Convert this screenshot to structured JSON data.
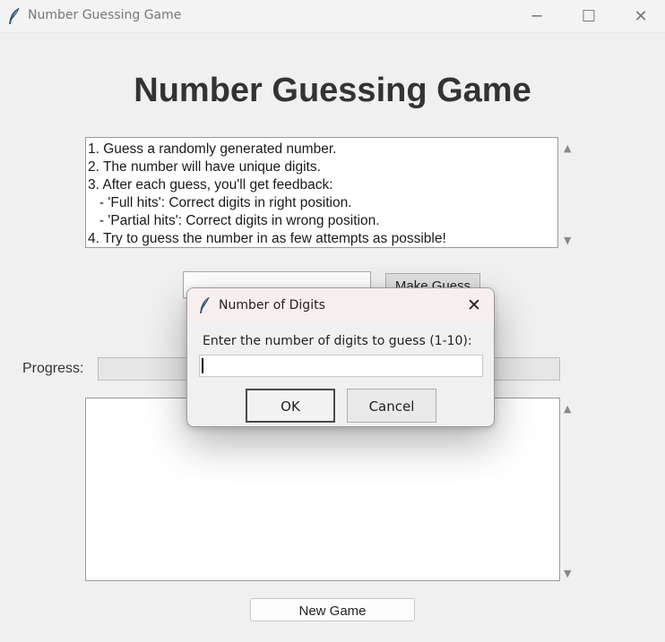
{
  "window": {
    "title": "Number Guessing Game",
    "controls": {
      "minimize": "─",
      "maximize": "☐",
      "close": "✕"
    }
  },
  "main": {
    "heading": "Number Guessing Game",
    "rules": [
      "1. Guess a randomly generated number.",
      "2. The number will have unique digits.",
      "3. After each guess, you'll get feedback:",
      "   - 'Full hits': Correct digits in right position.",
      "   - 'Partial hits': Correct digits in wrong position.",
      "4. Try to guess the number in as few attempts as possible!"
    ],
    "guess_input": {
      "value": ""
    },
    "make_guess_label": "Make Guess",
    "progress_label": "Progress:",
    "progress_value": 0,
    "new_game_label": "New Game"
  },
  "dialog": {
    "title": "Number of Digits",
    "close": "✕",
    "prompt": "Enter the number of digits to guess (1-10):",
    "input_value": "",
    "ok_label": "OK",
    "cancel_label": "Cancel"
  },
  "icons": {
    "app": "feather-icon",
    "dialog": "feather-icon",
    "scroll_up": "▲",
    "scroll_down": "▼"
  }
}
